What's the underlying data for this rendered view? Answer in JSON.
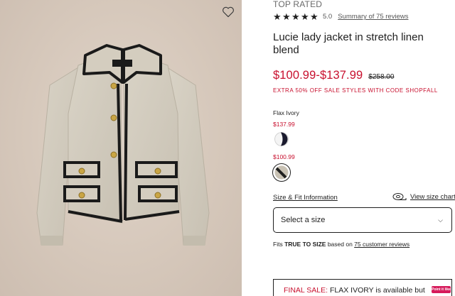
{
  "product": {
    "badge": "TOP RATED",
    "rating": "5.0",
    "rating_stars": 5,
    "reviews_summary": "Summary of 75 reviews",
    "title": "Lucie lady jacket in stretch linen blend",
    "price_range": "$100.99-$137.99",
    "original_price": "$258.00",
    "promo": "EXTRA 50% OFF SALE STYLES WITH CODE SHOPFALL",
    "color_name": "Flax Ivory",
    "swatches": [
      {
        "price": "$137.99",
        "colors": [
          "#f4f4f4",
          "#1a1a2e"
        ],
        "selected": false
      },
      {
        "price": "$100.99",
        "colors": [
          "#c9c2b4",
          "#1f1f1f"
        ],
        "selected": true
      }
    ]
  },
  "sizing": {
    "size_fit_link": "Size & Fit Information",
    "size_chart_link": "View size chart",
    "select_label": "Select a size",
    "fit_prefix": "Fits ",
    "fit_emphasis": "TRUE TO SIZE",
    "fit_middle": " based on ",
    "fit_reviews": "75 customer reviews"
  },
  "notice": {
    "label": "FINAL SALE:",
    "text": " FLAX IVORY is available but",
    "badge": "Point it like"
  },
  "colors": {
    "sale_red": "#c8102e",
    "text": "#1f1f1f",
    "image_bg": "#d8cabe",
    "badge_pink": "#d61a5b"
  },
  "icons": {
    "wishlist": "heart-outline-icon",
    "star": "star-filled-icon",
    "size_chart": "measuring-tape-icon",
    "select": "chevron-down-icon"
  }
}
